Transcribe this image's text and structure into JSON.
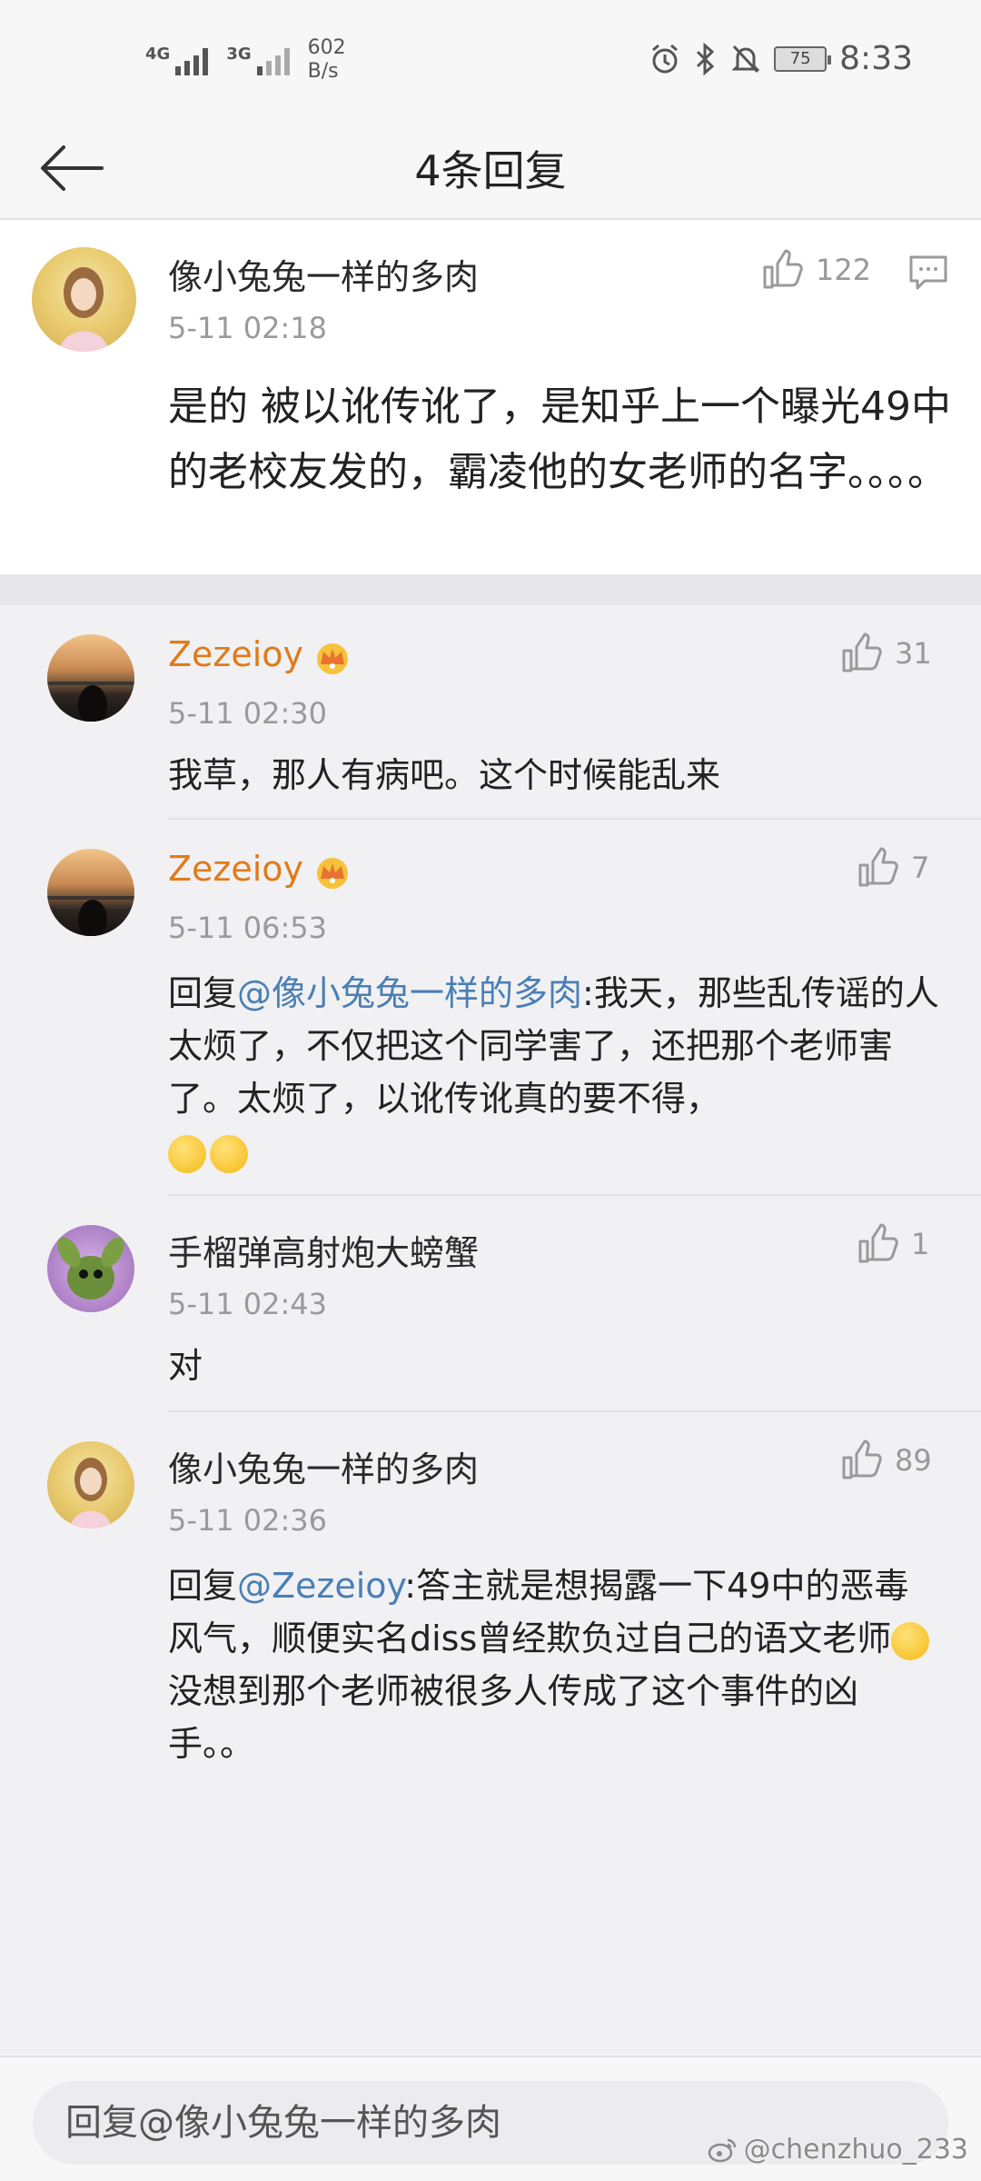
{
  "status_bar": {
    "signal1_label": "4G",
    "signal2_label": "3G",
    "net_speed": "602",
    "net_speed_unit": "B/s",
    "battery": "75",
    "time": "8:33"
  },
  "header": {
    "title": "4条回复"
  },
  "main_comment": {
    "author": "像小兔兔一样的多肉",
    "time": "5-11 02:18",
    "likes": "122",
    "text": "是的 被以讹传讹了，是知乎上一个曝光49中的老校友发的，霸凌他的女老师的名字。。。。"
  },
  "replies": [
    {
      "author": "Zezeioy",
      "time": "5-11 02:30",
      "likes": "31",
      "prefix": "",
      "mention": "",
      "text": "我草，那人有病吧。这个时候能乱来"
    },
    {
      "author": "Zezeioy",
      "time": "5-11 06:53",
      "likes": "7",
      "prefix": "回复",
      "mention": "@像小兔兔一样的多肉",
      "text": ":我天，那些乱传谣的人太烦了，不仅把这个同学害了，还把那个老师害了。太烦了，以讹传讹真的要不得，"
    },
    {
      "author": "手榴弹高射炮大螃蟹",
      "time": "5-11 02:43",
      "likes": "1",
      "prefix": "",
      "mention": "",
      "text": "对"
    },
    {
      "author": "像小兔兔一样的多肉",
      "time": "5-11 02:36",
      "likes": "89",
      "prefix": "回复",
      "mention": "@Zezeioy",
      "text": ":答主就是想揭露一下49中的恶毒风气，顺便实名diss曾经欺负过自己的语文老师",
      "text_after_emoji": "没想到那个老师被很多人传成了这个事件的凶手。。"
    }
  ],
  "bottom": {
    "input_placeholder": "回复@像小兔兔一样的多肉",
    "watermark": "@chenzhuo_233"
  },
  "colors": {
    "mention": "#4a7fb5",
    "vip_name": "#e07b1a",
    "background": "#f1f1f3"
  }
}
